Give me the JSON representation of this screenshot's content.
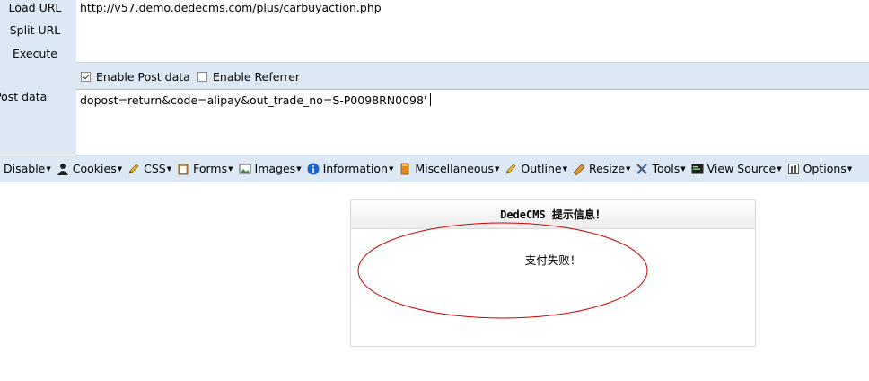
{
  "hackbar": {
    "buttons": {
      "load_url": "Load URL",
      "split_url": "Split URL",
      "execute": "Execute"
    },
    "url": "http://v57.demo.dedecms.com/plus/carbuyaction.php",
    "options": {
      "enable_post": {
        "label": "Enable Post data",
        "checked": true
      },
      "enable_referrer": {
        "label": "Enable Referrer",
        "checked": false
      }
    },
    "post_label": "Post data",
    "post_data": "dopost=return&code=alipay&out_trade_no=S-P0098RN0098'"
  },
  "toolbar": {
    "items": [
      {
        "label": "Disable",
        "icon": "disable-icon"
      },
      {
        "label": "Cookies",
        "icon": "cookies-icon"
      },
      {
        "label": "CSS",
        "icon": "css-pencil-icon"
      },
      {
        "label": "Forms",
        "icon": "forms-clipboard-icon"
      },
      {
        "label": "Images",
        "icon": "images-icon"
      },
      {
        "label": "Information",
        "icon": "information-icon"
      },
      {
        "label": "Miscellaneous",
        "icon": "miscellaneous-icon"
      },
      {
        "label": "Outline",
        "icon": "outline-pencil-icon"
      },
      {
        "label": "Resize",
        "icon": "resize-ruler-icon"
      },
      {
        "label": "Tools",
        "icon": "tools-icon"
      },
      {
        "label": "View Source",
        "icon": "view-source-icon"
      },
      {
        "label": "Options",
        "icon": "options-icon"
      }
    ]
  },
  "message": {
    "header": "DedeCMS 提示信息！",
    "body": "支付失败！"
  },
  "colors": {
    "panel_bg": "#dce9f5",
    "annotation_ellipse": "#cc0000",
    "info_blue": "#1f63c9"
  }
}
